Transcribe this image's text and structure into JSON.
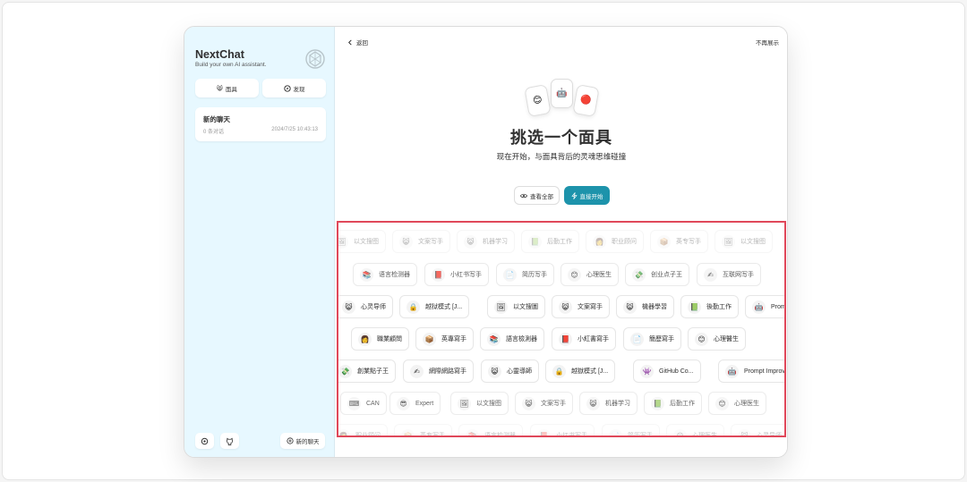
{
  "sidebar": {
    "title": "NextChat",
    "subtitle": "Build your own AI assistant.",
    "mask_button": "面具",
    "discover_button": "发现",
    "chat": {
      "title": "新的聊天",
      "count": "0 条对话",
      "time": "2024/7/25 10:43:13"
    },
    "new_chat_button": "新的聊天"
  },
  "main": {
    "back_label": "返回",
    "no_show_label": "不再展示",
    "title": "挑选一个面具",
    "subtitle": "现在开始，与面具背后的灵魂思维碰撞",
    "view_all_button": "查看全部",
    "start_button": "直接开始",
    "avatar_emojis": [
      "😊",
      "🤖",
      "🔴"
    ]
  },
  "mask_rows": [
    {
      "opacity": 0.35,
      "items": [
        {
          "emoji": "🖼",
          "name": "以文搜图"
        },
        {
          "emoji": "😸",
          "name": "文案写手"
        },
        {
          "emoji": "😸",
          "name": "机器学习"
        },
        {
          "emoji": "📗",
          "name": "后勤工作"
        },
        {
          "emoji": "👩",
          "name": "职业顾问"
        },
        {
          "emoji": "📦",
          "name": "英专写手"
        },
        {
          "emoji": "🖼",
          "name": "以文搜图"
        }
      ]
    },
    {
      "opacity": 0.8,
      "items": [
        {
          "emoji": "📚",
          "name": "语言检测器"
        },
        {
          "emoji": "📕",
          "name": "小红书写手"
        },
        {
          "emoji": "📄",
          "name": "简历写手"
        },
        {
          "emoji": "😊",
          "name": "心理医生"
        },
        {
          "emoji": "💸",
          "name": "创业点子王"
        },
        {
          "emoji": "✍",
          "name": "互联网写手"
        }
      ]
    },
    {
      "opacity": 1,
      "items": [
        {
          "emoji": "😸",
          "name": "心灵导师"
        },
        {
          "emoji": "🔒",
          "name": "越狱模式 [J..."
        },
        {
          "emoji": "🖼",
          "name": "以文搜圖"
        },
        {
          "emoji": "😸",
          "name": "文案寫手"
        },
        {
          "emoji": "😸",
          "name": "機器學習"
        },
        {
          "emoji": "📗",
          "name": "後勤工作"
        },
        {
          "emoji": "🤖",
          "name": "Prompt Improvement"
        }
      ]
    },
    {
      "opacity": 1,
      "items": [
        {
          "emoji": "👩",
          "name": "職業顧問"
        },
        {
          "emoji": "📦",
          "name": "英專寫手"
        },
        {
          "emoji": "📚",
          "name": "語言檢測器"
        },
        {
          "emoji": "📕",
          "name": "小紅書寫手"
        },
        {
          "emoji": "📄",
          "name": "簡歷寫手"
        },
        {
          "emoji": "😊",
          "name": "心理醫生"
        }
      ]
    },
    {
      "opacity": 1,
      "items": [
        {
          "emoji": "💸",
          "name": "創業點子王"
        },
        {
          "emoji": "✍",
          "name": "網際網路寫手"
        },
        {
          "emoji": "😸",
          "name": "心靈導師"
        },
        {
          "emoji": "🔒",
          "name": "越獄模式 [J..."
        },
        {
          "emoji": "👾",
          "name": "GitHub Co..."
        },
        {
          "emoji": "🤖",
          "name": "Prompt Improvement"
        }
      ]
    },
    {
      "opacity": 0.75,
      "items": [
        {
          "emoji": "⌨",
          "name": "CAN"
        },
        {
          "emoji": "😎",
          "name": "Expert"
        },
        {
          "emoji": "🖼",
          "name": "以文搜图"
        },
        {
          "emoji": "😸",
          "name": "文案写手"
        },
        {
          "emoji": "😸",
          "name": "机器学习"
        },
        {
          "emoji": "📗",
          "name": "后勤工作"
        },
        {
          "emoji": "😊",
          "name": "心理医生"
        }
      ]
    },
    {
      "opacity": 0.3,
      "items": [
        {
          "emoji": "👩",
          "name": "职业顾问"
        },
        {
          "emoji": "📦",
          "name": "英专写手"
        },
        {
          "emoji": "📚",
          "name": "语言检测器"
        },
        {
          "emoji": "📕",
          "name": "小红书写手"
        },
        {
          "emoji": "📄",
          "name": "简历写手"
        },
        {
          "emoji": "😊",
          "name": "心理医生"
        },
        {
          "emoji": "😸",
          "name": "心灵导师"
        }
      ]
    }
  ]
}
